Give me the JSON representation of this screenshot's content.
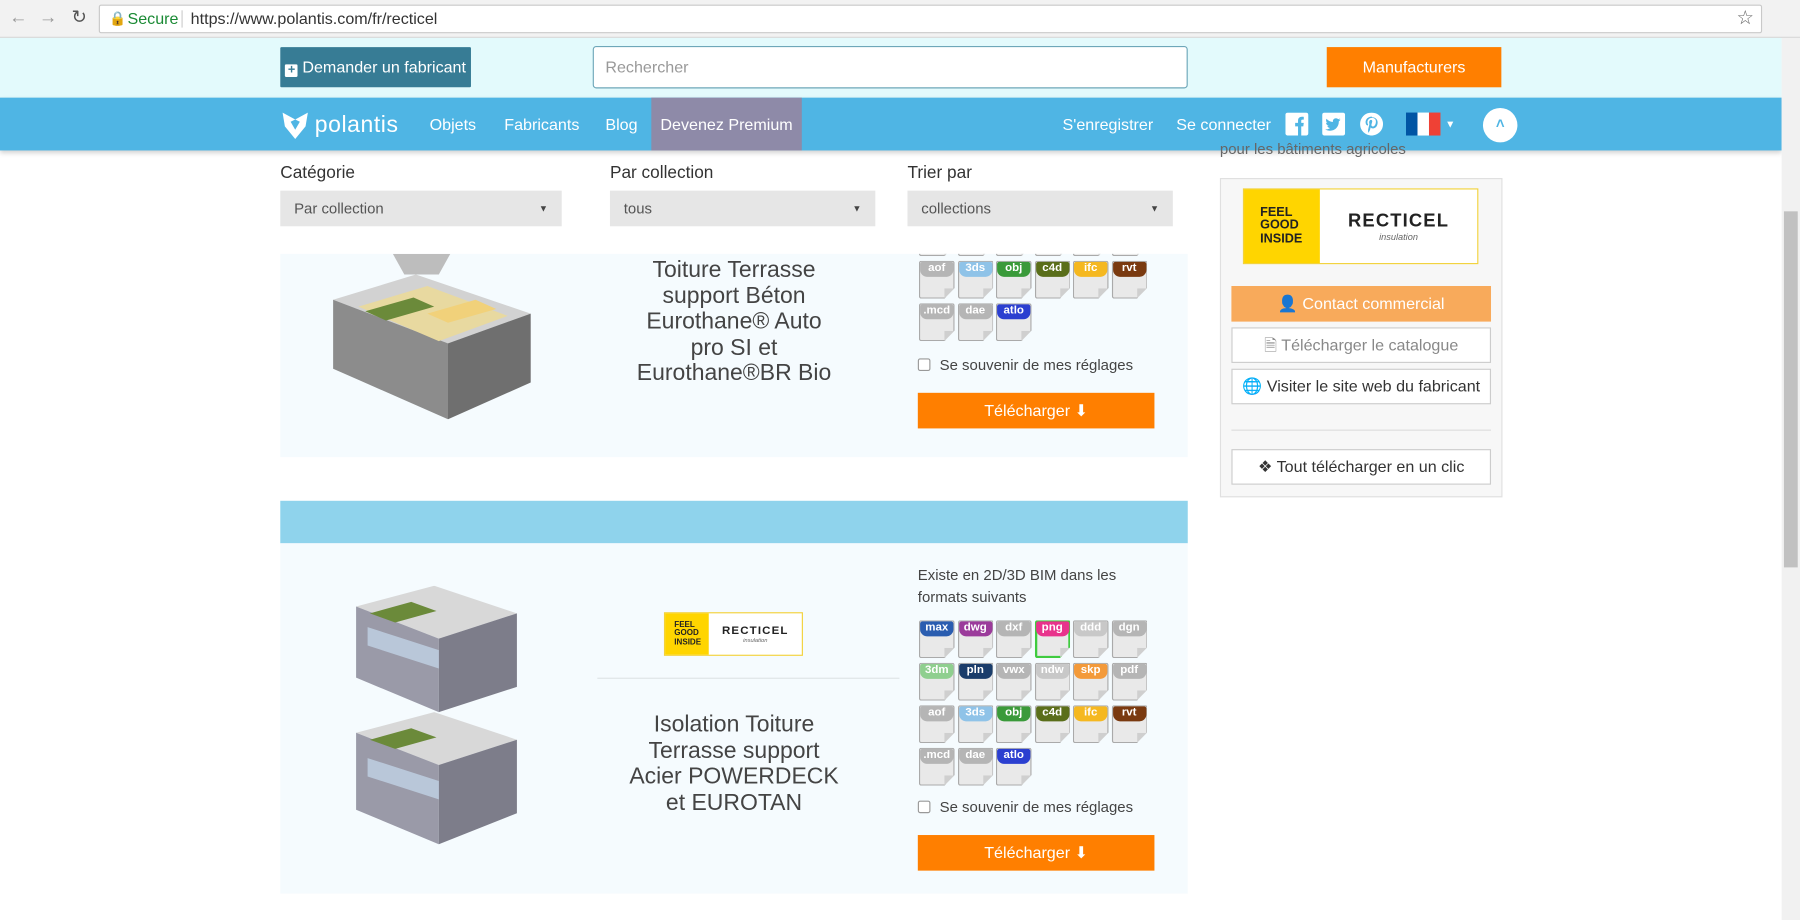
{
  "browser": {
    "secure_label": "Secure",
    "url": "https://www.polantis.com/fr/recticel"
  },
  "topbar": {
    "ask_manufacturer": "Demander un fabricant",
    "search_placeholder": "Rechercher",
    "manufacturers": "Manufacturers"
  },
  "nav": {
    "logo": "polantis",
    "items": [
      "Objets",
      "Fabricants",
      "Blog"
    ],
    "premium": "Devenez Premium",
    "register": "S'enregistrer",
    "login": "Se connecter",
    "social": [
      "facebook-icon",
      "twitter-icon",
      "pinterest-icon"
    ],
    "flag_colors": [
      "#0055a4",
      "#ffffff",
      "#ef4135"
    ]
  },
  "filters": {
    "category_label": "Catégorie",
    "category_value": "Par collection",
    "collection_label": "Par collection",
    "collection_value": "tous",
    "sort_label": "Trier par",
    "sort_value": "collections"
  },
  "products": [
    {
      "title_lines": [
        "Toiture Terrasse",
        "support Béton",
        "Eurothane® Auto",
        "pro SI et",
        "Eurothane®BR Bio"
      ],
      "remember": "Se souvenir de mes réglages",
      "download": "Télécharger"
    },
    {
      "brand": "RECTICEL",
      "exists_text": "Existe en 2D/3D BIM dans les formats suivants",
      "title_lines": [
        "Isolation Toiture",
        "Terrasse support",
        "Acier POWERDECK",
        "et EUROTAN"
      ],
      "remember": "Se souvenir de mes réglages",
      "download": "Télécharger"
    }
  ],
  "formats": [
    {
      "label": "max",
      "color": "#2a5db0"
    },
    {
      "label": "dwg",
      "color": "#9b3b9b"
    },
    {
      "label": "dxf",
      "color": "#b5b5b5"
    },
    {
      "label": "png",
      "color": "#e8338c",
      "selected": true
    },
    {
      "label": "ddd",
      "color": "#c8c8c8"
    },
    {
      "label": "dgn",
      "color": "#b5b5b5"
    },
    {
      "label": "3dm",
      "color": "#8fcf8f"
    },
    {
      "label": "pln",
      "color": "#1a3d6b"
    },
    {
      "label": "vwx",
      "color": "#b5b5b5"
    },
    {
      "label": "ndw",
      "color": "#c8c8c8"
    },
    {
      "label": "skp",
      "color": "#f39a3a"
    },
    {
      "label": "pdf",
      "color": "#b5b5b5"
    },
    {
      "label": "aof",
      "color": "#b5b5b5"
    },
    {
      "label": "3ds",
      "color": "#8fc3e8"
    },
    {
      "label": "obj",
      "color": "#3a9a3a"
    },
    {
      "label": "c4d",
      "color": "#5a6e1a"
    },
    {
      "label": "ifc",
      "color": "#f5b820"
    },
    {
      "label": "rvt",
      "color": "#7a3a10"
    },
    {
      "label": ".mcd",
      "color": "#b5b5b5"
    },
    {
      "label": "dae",
      "color": "#b5b5b5"
    },
    {
      "label": "atlo",
      "color": "#2b3fd0"
    }
  ],
  "sidebar": {
    "partial_text": "pour les bâtiments agricoles",
    "brand_tagline": [
      "FEEL",
      "GOOD",
      "INSIDE"
    ],
    "brand_name": "RECTICEL",
    "brand_sub": "insulation",
    "contact": "Contact commercial",
    "catalogue": "Télécharger le catalogue",
    "website": "Visiter le site web du fabricant",
    "download_all": "Tout télécharger en un clic"
  }
}
